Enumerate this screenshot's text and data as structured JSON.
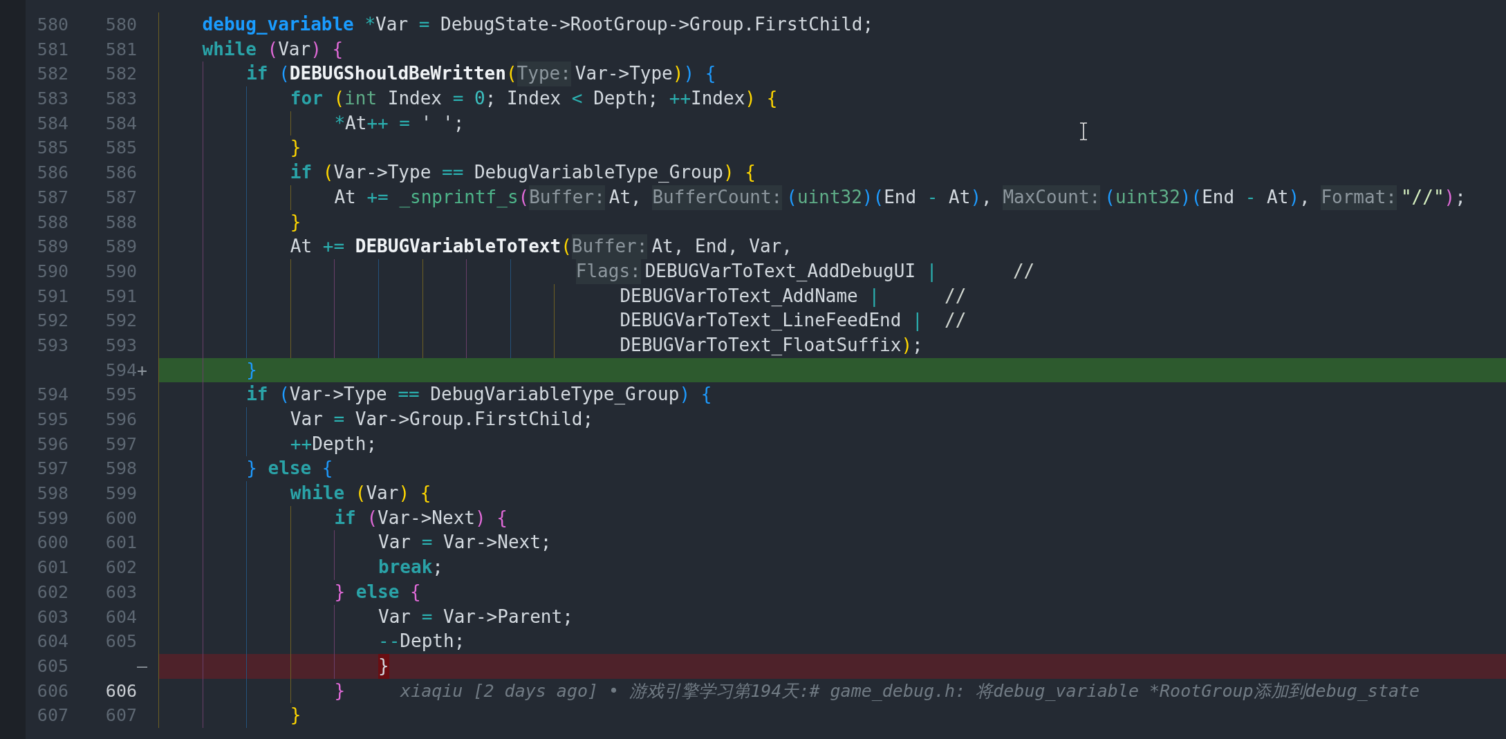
{
  "lines": [
    {
      "kind": "context",
      "old": "580",
      "new": "580",
      "current": false,
      "tokens": [
        {
          "kind": "type",
          "s": "    debug_variable "
        },
        {
          "kind": "op",
          "s": "*"
        },
        {
          "kind": "plain",
          "s": "Var "
        },
        {
          "kind": "op",
          "s": "="
        },
        {
          "kind": "plain",
          "s": " DebugState->RootGroup->Group.FirstChild;"
        }
      ]
    },
    {
      "kind": "context",
      "old": "581",
      "new": "581",
      "current": false,
      "tokens": [
        {
          "kind": "kw",
          "s": "    while "
        },
        {
          "kind": "brm",
          "s": "("
        },
        {
          "kind": "plain",
          "s": "Var"
        },
        {
          "kind": "brm",
          "s": ") {"
        }
      ]
    },
    {
      "kind": "context",
      "old": "582",
      "new": "582",
      "current": false,
      "tokens": [
        {
          "kind": "kw",
          "s": "        if "
        },
        {
          "kind": "brb",
          "s": "("
        },
        {
          "kind": "fn",
          "s": "DEBUGShouldBeWritten"
        },
        {
          "kind": "bry",
          "s": "("
        },
        {
          "kind": "hint",
          "s": "Type:"
        },
        {
          "kind": "plain",
          "s": "Var->Type"
        },
        {
          "kind": "bry",
          "s": ")"
        },
        {
          "kind": "brb",
          "s": ") {"
        }
      ]
    },
    {
      "kind": "context",
      "old": "583",
      "new": "583",
      "current": false,
      "tokens": [
        {
          "kind": "kw",
          "s": "            for "
        },
        {
          "kind": "bry",
          "s": "("
        },
        {
          "kind": "prim",
          "s": "int"
        },
        {
          "kind": "plain",
          "s": " Index "
        },
        {
          "kind": "op",
          "s": "= "
        },
        {
          "kind": "num",
          "s": "0"
        },
        {
          "kind": "plain",
          "s": "; Index "
        },
        {
          "kind": "op",
          "s": "<"
        },
        {
          "kind": "plain",
          "s": " Depth; "
        },
        {
          "kind": "op",
          "s": "++"
        },
        {
          "kind": "plain",
          "s": "Index"
        },
        {
          "kind": "bry",
          "s": ") {"
        }
      ]
    },
    {
      "kind": "context",
      "old": "584",
      "new": "584",
      "current": false,
      "tokens": [
        {
          "kind": "op",
          "s": "                *"
        },
        {
          "kind": "plain",
          "s": "At"
        },
        {
          "kind": "op",
          "s": "++ ="
        },
        {
          "kind": "plain",
          "s": " ' ';"
        }
      ]
    },
    {
      "kind": "context",
      "old": "585",
      "new": "585",
      "current": false,
      "tokens": [
        {
          "kind": "bry",
          "s": "            }"
        }
      ]
    },
    {
      "kind": "context",
      "old": "586",
      "new": "586",
      "current": false,
      "tokens": [
        {
          "kind": "kw",
          "s": "            if "
        },
        {
          "kind": "bry",
          "s": "("
        },
        {
          "kind": "plain",
          "s": "Var->Type "
        },
        {
          "kind": "op",
          "s": "=="
        },
        {
          "kind": "plain",
          "s": " DebugVariableType_Group"
        },
        {
          "kind": "bry",
          "s": ") {"
        }
      ]
    },
    {
      "kind": "context",
      "old": "587",
      "new": "587",
      "current": false,
      "tokens": [
        {
          "kind": "plain",
          "s": "                At "
        },
        {
          "kind": "op",
          "s": "+= "
        },
        {
          "kind": "call",
          "s": "_snprintf_s"
        },
        {
          "kind": "brm",
          "s": "("
        },
        {
          "kind": "hint",
          "s": "Buffer:"
        },
        {
          "kind": "plain",
          "s": "At, "
        },
        {
          "kind": "hint",
          "s": "BufferCount:"
        },
        {
          "kind": "brb",
          "s": "("
        },
        {
          "kind": "prim",
          "s": "uint32"
        },
        {
          "kind": "brb",
          "s": ")("
        },
        {
          "kind": "plain",
          "s": "End "
        },
        {
          "kind": "op",
          "s": "-"
        },
        {
          "kind": "plain",
          "s": " At"
        },
        {
          "kind": "brb",
          "s": ")"
        },
        {
          "kind": "plain",
          "s": ", "
        },
        {
          "kind": "hint",
          "s": "MaxCount:"
        },
        {
          "kind": "brb",
          "s": "("
        },
        {
          "kind": "prim",
          "s": "uint32"
        },
        {
          "kind": "brb",
          "s": ")("
        },
        {
          "kind": "plain",
          "s": "End "
        },
        {
          "kind": "op",
          "s": "-"
        },
        {
          "kind": "plain",
          "s": " At"
        },
        {
          "kind": "brb",
          "s": ")"
        },
        {
          "kind": "plain",
          "s": ", "
        },
        {
          "kind": "hint",
          "s": "Format:"
        },
        {
          "kind": "str",
          "s": "\"//\""
        },
        {
          "kind": "brm",
          "s": ")"
        },
        {
          "kind": "plain",
          "s": ";"
        }
      ]
    },
    {
      "kind": "context",
      "old": "588",
      "new": "588",
      "current": false,
      "tokens": [
        {
          "kind": "bry",
          "s": "            }"
        }
      ]
    },
    {
      "kind": "context",
      "old": "589",
      "new": "589",
      "current": false,
      "tokens": [
        {
          "kind": "plain",
          "s": "            At "
        },
        {
          "kind": "op",
          "s": "+= "
        },
        {
          "kind": "fn",
          "s": "DEBUGVariableToText"
        },
        {
          "kind": "bry",
          "s": "("
        },
        {
          "kind": "hint",
          "s": "Buffer:"
        },
        {
          "kind": "plain",
          "s": "At, End, Var,"
        }
      ]
    },
    {
      "kind": "context",
      "old": "590",
      "new": "590",
      "current": false,
      "tokens": [
        {
          "kind": "hint",
          "s": "                                      Flags:"
        },
        {
          "kind": "plain",
          "s": "DEBUGVarToText_AddDebugUI "
        },
        {
          "kind": "op",
          "s": "|       "
        },
        {
          "kind": "comment",
          "s": "//"
        }
      ]
    },
    {
      "kind": "context",
      "old": "591",
      "new": "591",
      "current": false,
      "tokens": [
        {
          "kind": "plain",
          "s": "                                          DEBUGVarToText_AddName "
        },
        {
          "kind": "op",
          "s": "|      "
        },
        {
          "kind": "comment",
          "s": "//"
        }
      ]
    },
    {
      "kind": "context",
      "old": "592",
      "new": "592",
      "current": false,
      "tokens": [
        {
          "kind": "plain",
          "s": "                                          DEBUGVarToText_LineFeedEnd "
        },
        {
          "kind": "op",
          "s": "|  "
        },
        {
          "kind": "comment",
          "s": "//"
        }
      ]
    },
    {
      "kind": "context",
      "old": "593",
      "new": "593",
      "current": false,
      "tokens": [
        {
          "kind": "plain",
          "s": "                                          DEBUGVarToText_FloatSuffix"
        },
        {
          "kind": "bry",
          "s": ")"
        },
        {
          "kind": "plain",
          "s": ";"
        }
      ]
    },
    {
      "kind": "added",
      "new": "594",
      "marker": "+",
      "current": false,
      "tokens": [
        {
          "kind": "brb",
          "s": "        }"
        }
      ]
    },
    {
      "kind": "context",
      "old": "594",
      "new": "595",
      "current": false,
      "tokens": [
        {
          "kind": "kw",
          "s": "        if "
        },
        {
          "kind": "brb",
          "s": "("
        },
        {
          "kind": "plain",
          "s": "Var->Type "
        },
        {
          "kind": "op",
          "s": "=="
        },
        {
          "kind": "plain",
          "s": " DebugVariableType_Group"
        },
        {
          "kind": "brb",
          "s": ") {"
        }
      ]
    },
    {
      "kind": "context",
      "old": "595",
      "new": "596",
      "current": false,
      "tokens": [
        {
          "kind": "plain",
          "s": "            Var "
        },
        {
          "kind": "op",
          "s": "="
        },
        {
          "kind": "plain",
          "s": " Var->Group.FirstChild;"
        }
      ]
    },
    {
      "kind": "context",
      "old": "596",
      "new": "597",
      "current": false,
      "tokens": [
        {
          "kind": "op",
          "s": "            ++"
        },
        {
          "kind": "plain",
          "s": "Depth;"
        }
      ]
    },
    {
      "kind": "context",
      "old": "597",
      "new": "598",
      "current": false,
      "tokens": [
        {
          "kind": "brb",
          "s": "        } "
        },
        {
          "kind": "kw",
          "s": "else "
        },
        {
          "kind": "brb",
          "s": "{"
        }
      ]
    },
    {
      "kind": "context",
      "old": "598",
      "new": "599",
      "current": false,
      "tokens": [
        {
          "kind": "kw",
          "s": "            while "
        },
        {
          "kind": "bry",
          "s": "("
        },
        {
          "kind": "plain",
          "s": "Var"
        },
        {
          "kind": "bry",
          "s": ") {"
        }
      ]
    },
    {
      "kind": "context",
      "old": "599",
      "new": "600",
      "current": false,
      "tokens": [
        {
          "kind": "kw",
          "s": "                if "
        },
        {
          "kind": "brm",
          "s": "("
        },
        {
          "kind": "plain",
          "s": "Var->Next"
        },
        {
          "kind": "brm",
          "s": ") {"
        }
      ]
    },
    {
      "kind": "context",
      "old": "600",
      "new": "601",
      "current": false,
      "tokens": [
        {
          "kind": "plain",
          "s": "                    Var "
        },
        {
          "kind": "op",
          "s": "="
        },
        {
          "kind": "plain",
          "s": " Var->Next;"
        }
      ]
    },
    {
      "kind": "context",
      "old": "601",
      "new": "602",
      "current": false,
      "tokens": [
        {
          "kind": "kw",
          "s": "                    break"
        },
        {
          "kind": "plain",
          "s": ";"
        }
      ]
    },
    {
      "kind": "context",
      "old": "602",
      "new": "603",
      "current": false,
      "tokens": [
        {
          "kind": "brm",
          "s": "                } "
        },
        {
          "kind": "kw",
          "s": "else "
        },
        {
          "kind": "brm",
          "s": "{"
        }
      ]
    },
    {
      "kind": "context",
      "old": "603",
      "new": "604",
      "current": false,
      "tokens": [
        {
          "kind": "plain",
          "s": "                    Var "
        },
        {
          "kind": "op",
          "s": "="
        },
        {
          "kind": "plain",
          "s": " Var->Parent;"
        }
      ]
    },
    {
      "kind": "context",
      "old": "604",
      "new": "605",
      "current": false,
      "tokens": [
        {
          "kind": "op",
          "s": "                    --"
        },
        {
          "kind": "plain",
          "s": "Depth;"
        }
      ]
    },
    {
      "kind": "removed",
      "old": "605",
      "marker": "—",
      "tokens": [
        {
          "kind": "match",
          "s": "                    }"
        }
      ]
    },
    {
      "kind": "context",
      "old": "606",
      "new": "606",
      "current": true,
      "tokens": [
        {
          "kind": "brm",
          "s": "                }"
        }
      ],
      "blame": "xiaqiu [2 days ago] • 游戏引擎学习第194天:# game_debug.h: 将debug_variable *RootGroup添加到debug_state"
    },
    {
      "kind": "context",
      "old": "607",
      "new": "607",
      "current": false,
      "tokens": [
        {
          "kind": "bry",
          "s": "            }"
        }
      ]
    }
  ]
}
